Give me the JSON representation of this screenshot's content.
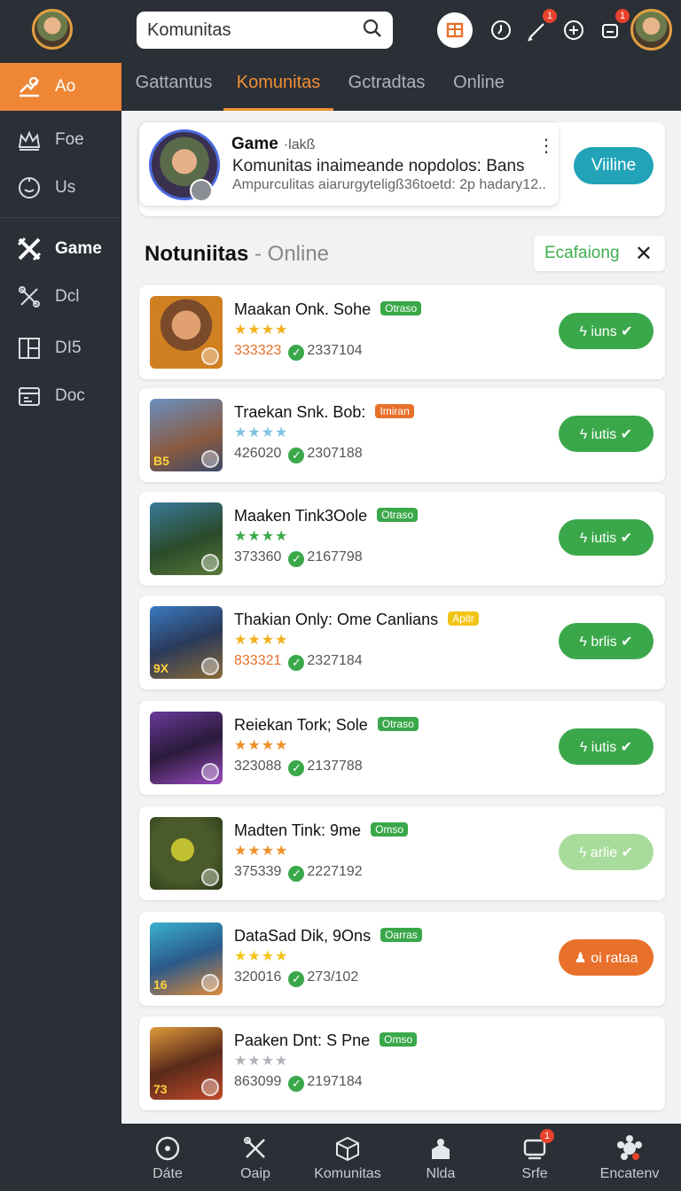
{
  "sidebar": {
    "items": [
      {
        "label": "Ao",
        "icon": "announce-icon"
      },
      {
        "label": "Foe",
        "icon": "crown-icon"
      },
      {
        "label": "Us",
        "icon": "smile-icon"
      },
      {
        "label": "Game",
        "icon": "crossed-swords-icon"
      },
      {
        "label": "Dcl",
        "icon": "tools-icon"
      },
      {
        "label": "DI5",
        "icon": "layout-icon"
      },
      {
        "label": "Doc",
        "icon": "calendar-icon"
      }
    ]
  },
  "search": {
    "value": "Komunitas"
  },
  "topbar": {
    "badge1": "1",
    "badge2": "1"
  },
  "tabs": [
    "Gattantus",
    "Komunitas",
    "Gctradtas",
    "Online"
  ],
  "featured": {
    "title": "Game",
    "title_suffix": "·lakß",
    "line1": "Komunitas inaimeande nopdolos: Bans",
    "line2": "Ampurculitas aiarurgyteligß36toetd: 2p hadary12..",
    "more": "⋮",
    "button": "Viiline"
  },
  "section": {
    "title": "Notuniitas",
    "sep": " - ",
    "subtitle": "Online"
  },
  "filter": {
    "label": "Ecafaiong",
    "close": "✕"
  },
  "rows": [
    {
      "title": "Maakan Onk. Sohe",
      "badge": "Otraso",
      "badge_color": "#3aa84a",
      "stars": "★★★★",
      "stars_color": "#f2b01e",
      "num1": "333323",
      "num1_color": "#e8702a",
      "num2": "2337104",
      "button": "ϟ iuns ✔",
      "btn_color": "#3aa84a"
    },
    {
      "title": "Traekan Snk. Bob:",
      "badge": "Imiran",
      "badge_color": "#e8702a",
      "stars": "★★★★",
      "stars_color": "#7fc4e0",
      "num1": "426020",
      "num1_color": "#555555",
      "num2": "2307188",
      "button": "ϟ iutis ✔",
      "btn_color": "#3aa84a"
    },
    {
      "title": "Maaken Tink3Oole",
      "badge": "Otraso",
      "badge_color": "#3aa84a",
      "stars": "★★★★",
      "stars_color": "#3aa84a",
      "num1": "373360",
      "num1_color": "#555555",
      "num2": "2167798",
      "button": "ϟ iutis ✔",
      "btn_color": "#3aa84a"
    },
    {
      "title": "Thakian Only: Ome Canlians",
      "badge": "Apitr",
      "badge_color": "#f2c418",
      "stars": "★★★★",
      "stars_color": "#f2b01e",
      "num1": "833321",
      "num1_color": "#e8702a",
      "num2": "2327184",
      "button": "ϟ brlis ✔",
      "btn_color": "#3aa84a"
    },
    {
      "title": "Reiekan Tork; Sole",
      "badge": "Otraso",
      "badge_color": "#3aa84a",
      "stars": "★★★★",
      "stars_color": "#f0902a",
      "num1": "323088",
      "num1_color": "#555555",
      "num2": "2137788",
      "button": "ϟ iutis ✔",
      "btn_color": "#3aa84a"
    },
    {
      "title": "Madten Tink: 9me",
      "badge": "Omso",
      "badge_color": "#3aa84a",
      "stars": "★★★★",
      "stars_color": "#f0902a",
      "num1": "375339",
      "num1_color": "#555555",
      "num2": "2227192",
      "button": "ϟ arlie ✔",
      "btn_color": "#a8dc9c"
    },
    {
      "title": "DataSad Dik, 9Ons",
      "badge": "Oarras",
      "badge_color": "#3aa84a",
      "stars": "★★★★",
      "stars_color": "#f2c418",
      "num1": "320016",
      "num1_color": "#555555",
      "num2": "273/102",
      "button": "♟ oi rataa",
      "btn_color": "#e8702a"
    },
    {
      "title": "Paaken Dnt: S Pne",
      "badge": "Omso",
      "badge_color": "#3aa84a",
      "stars": "★★★★",
      "stars_color": "#b0b4ba",
      "num1": "863099",
      "num1_color": "#555555",
      "num2": "2197184",
      "button": "",
      "btn_color": ""
    }
  ],
  "thumb_tags": [
    "",
    "B5",
    "",
    "9X",
    "",
    "",
    "16",
    "73"
  ],
  "bottom_nav": [
    {
      "label": "Dáte",
      "icon": "compass-icon"
    },
    {
      "label": "Oaip",
      "icon": "tools-icon"
    },
    {
      "label": "Komunitas",
      "icon": "box-icon"
    },
    {
      "label": "Nlda",
      "icon": "home-icon"
    },
    {
      "label": "Srfe",
      "icon": "chat-icon",
      "badge": "1"
    },
    {
      "label": "Encatenv",
      "icon": "gear-icon"
    }
  ]
}
